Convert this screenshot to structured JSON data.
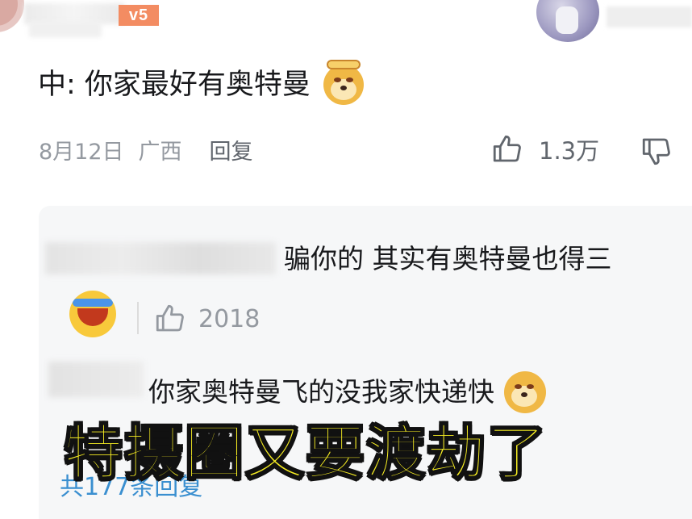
{
  "header": {
    "level_badge": "v5",
    "avatar_left_icon": "user-avatar",
    "avatar_right_icon": "user-avatar"
  },
  "comment": {
    "text": "中: 你家最好有奥特曼",
    "emoji": "doge-emoji",
    "date": "8月12日",
    "location": "广西",
    "reply_label": "回复",
    "like_count": "1.3万",
    "like_icon": "thumbs-up-icon",
    "dislike_icon": "thumbs-down-icon"
  },
  "replies": [
    {
      "text": "骗你的 其实有奥特曼也得三",
      "emoji": "laughing-crying-emoji",
      "like_count": "2018"
    },
    {
      "text": "你家奥特曼飞的没我家快递快",
      "emoji": "doge-emoji"
    }
  ],
  "more_replies": "共177条回复",
  "caption": "特摄圈又要渡劫了",
  "colors": {
    "caption_fill": "#f7ee22",
    "caption_stroke": "#111111",
    "link_blue": "#3a8fd0",
    "meta_gray": "#9499a0",
    "reply_bg": "#f6f7f8",
    "badge_orange": "#f38c62"
  }
}
